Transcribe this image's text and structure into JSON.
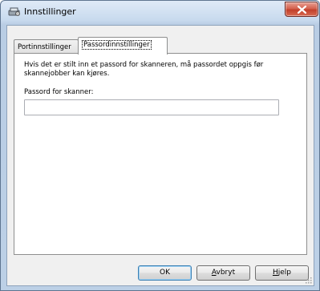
{
  "window": {
    "title": "Innstillinger",
    "icon": "settings-scanner-icon"
  },
  "tabs": [
    {
      "label": "Portinnstillinger",
      "active": false
    },
    {
      "label": "Passordinnstillinger",
      "active": true
    }
  ],
  "panel": {
    "description": "Hvis det er stilt inn et passord for skanneren, må passordet oppgis før skannejobber kan kjøres.",
    "password_label": "Passord for skanner:",
    "password_value": ""
  },
  "buttons": {
    "ok": "OK",
    "cancel_prefix": "",
    "cancel_mnemonic": "A",
    "cancel_rest": "vbryt",
    "help_prefix": "",
    "help_mnemonic": "H",
    "help_rest": "jelp"
  },
  "colors": {
    "titlebar": "#c8daee",
    "close_button": "#c2402b",
    "default_button_border": "#3c7fb1"
  }
}
